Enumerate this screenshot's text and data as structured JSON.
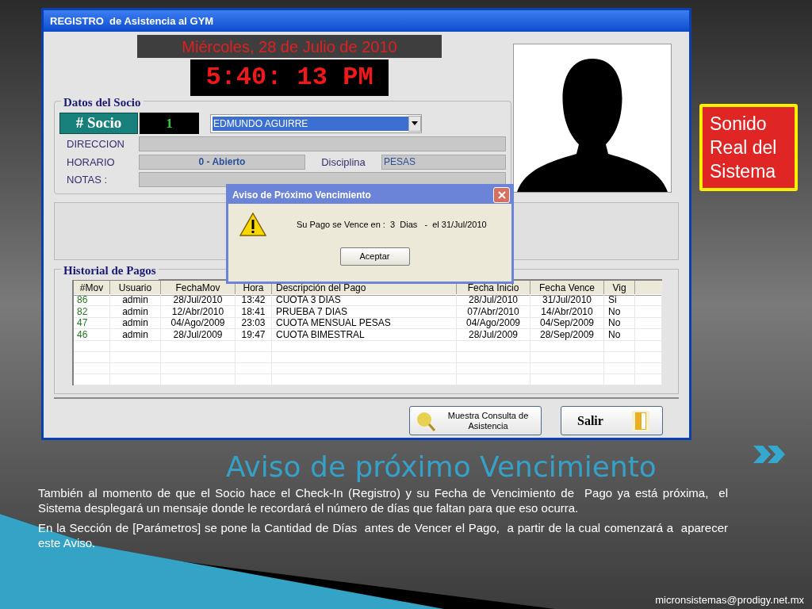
{
  "window": {
    "title": "REGISTRO  de Asistencia al GYM"
  },
  "date": "Miércoles, 28 de Julio de 2010",
  "clock": "5:40: 13 PM",
  "member": {
    "legend": "Datos del Socio",
    "badge": "# Socio",
    "number": "1",
    "name": "EDMUNDO AGUIRRE",
    "direccion": {
      "label": "DIRECCION"
    },
    "horario": {
      "label": "HORARIO",
      "value": "0 - Abierto"
    },
    "disciplina": {
      "label": "Disciplina",
      "value": "PESAS"
    },
    "notas": {
      "label": "NOTAS :"
    }
  },
  "payments": {
    "legend": "Historial de Pagos",
    "columns": [
      "#Mov",
      "Usuario",
      "FechaMov",
      "Hora",
      "Descripción del Pago",
      "Fecha Inicio",
      "Fecha Vence",
      "Vig"
    ],
    "rows": [
      [
        "86",
        "admin",
        "28/Jul/2010",
        "13:42",
        "CUOTA 3 DIAS",
        "28/Jul/2010",
        "31/Jul/2010",
        "Si"
      ],
      [
        "82",
        "admin",
        "12/Abr/2010",
        "18:41",
        "PRUEBA 7 DIAS",
        "07/Abr/2010",
        "14/Abr/2010",
        "No"
      ],
      [
        "47",
        "admin",
        "04/Ago/2009",
        "23:03",
        "CUOTA MENSUAL PESAS",
        "04/Ago/2009",
        "04/Sep/2009",
        "No"
      ],
      [
        "46",
        "admin",
        "28/Jul/2009",
        "19:47",
        "CUOTA BIMESTRAL",
        "28/Jul/2009",
        "28/Sep/2009",
        "No"
      ]
    ]
  },
  "buttons": [
    {
      "kind": "query",
      "label": "Muestra Consulta de Asistencia"
    },
    {
      "kind": "exit",
      "label": "Salir"
    }
  ],
  "dialog": {
    "title": "Aviso de Próximo Vencimiento",
    "message": "Su Pago se Vence en :  3  Dias   -  el 31/Jul/2010",
    "button": "Aceptar"
  },
  "slide": {
    "title": "Aviso de próximo Vencimiento",
    "paragraphs": [
      "También al momento de que el Socio hace el Check-In (Registro) y su Fecha de Vencimiento de  Pago ya está próxima,  el Sistema desplegará un mensaje donde le recordará el número de días que faltan para que eso ocurra.",
      "En la Sección de [Parámetros] se pone la Cantidad de Días  antes de Vencer el Pago,  a partir de la cual comenzará a  aparecer este Aviso."
    ],
    "callout": "Sonido Real del Sistema",
    "footer": "micronsistemas@prodigy.net.mx"
  }
}
